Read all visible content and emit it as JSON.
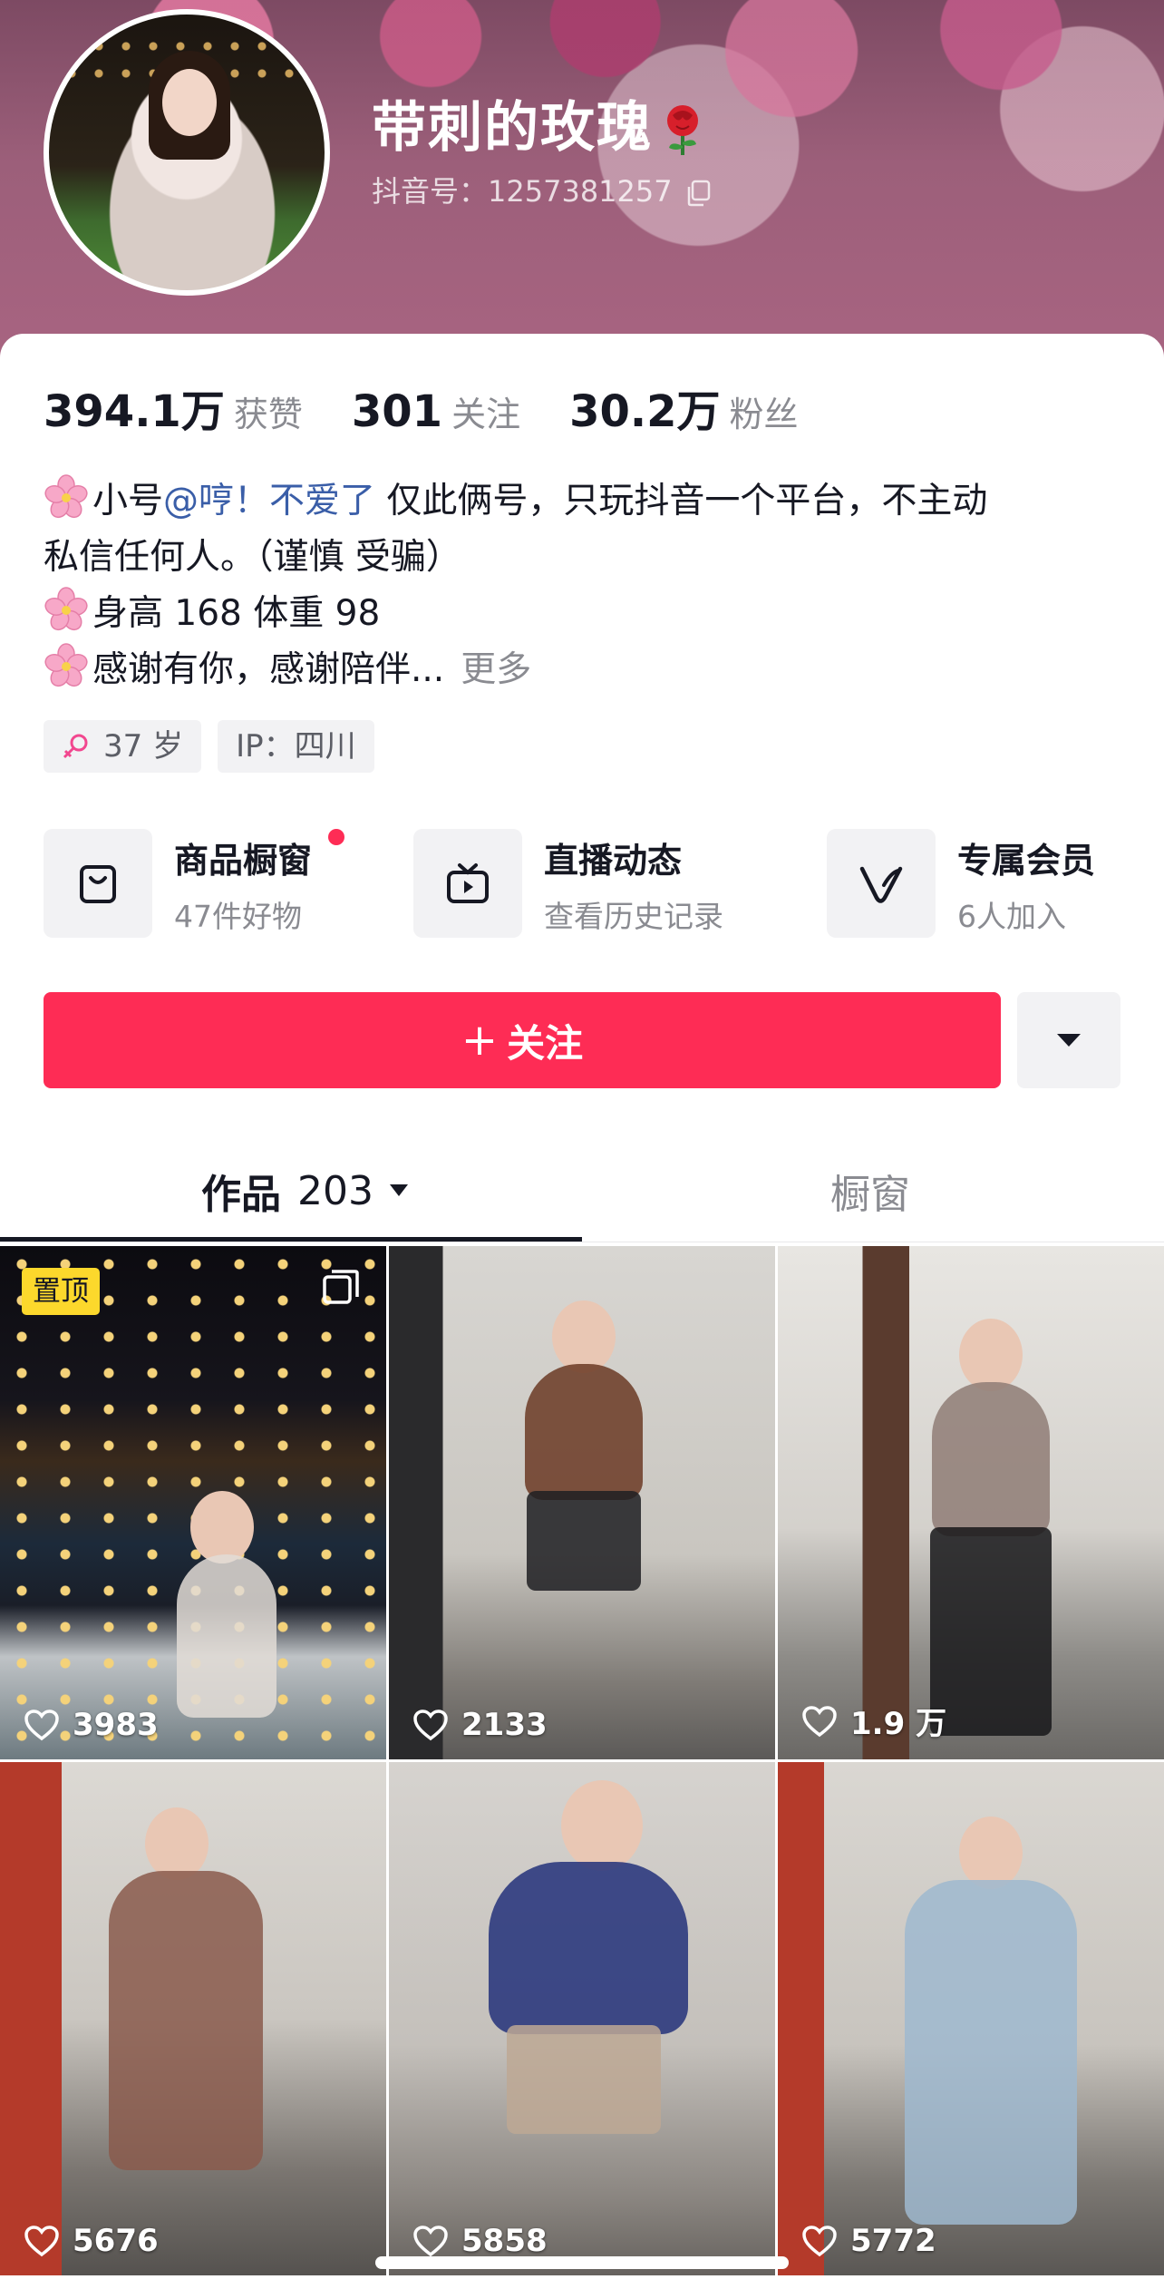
{
  "profile": {
    "username": "带刺的玫瑰",
    "id_label": "抖音号：",
    "id_value": "1257381257"
  },
  "stats": {
    "likes_value": "394.1万",
    "likes_label": "获赞",
    "following_value": "301",
    "following_label": "关注",
    "followers_value": "30.2万",
    "followers_label": "粉丝"
  },
  "bio": {
    "line1_prefix": "小号",
    "line1_mention": "@哼！不爱了",
    "line1_suffix": " 仅此俩号，只玩抖音一个平台，不主动",
    "line2": "私信任何人。（谨慎   受骗）",
    "line3": "身高 168 体重 98",
    "line4": "感谢有你，感谢陪伴...",
    "more": "更多"
  },
  "tags": {
    "age": "37 岁",
    "ip": "IP：四川"
  },
  "entries": [
    {
      "title": "商品橱窗",
      "subtitle": "47件好物",
      "icon": "shopping-bag-icon"
    },
    {
      "title": "直播动态",
      "subtitle": "查看历史记录",
      "icon": "live-tv-icon"
    },
    {
      "title": "专属会员",
      "subtitle": "6人加入",
      "icon": "member-v-icon"
    }
  ],
  "actions": {
    "follow_plus": "+",
    "follow_label": "关注"
  },
  "tabs": {
    "works_label": "作品",
    "works_count": "203",
    "showcase_label": "橱窗"
  },
  "grid": {
    "pinned_label": "置顶",
    "items": [
      {
        "likes": "3983"
      },
      {
        "likes": "2133"
      },
      {
        "likes": "1.9 万"
      },
      {
        "likes": "5676"
      },
      {
        "likes": "5858"
      },
      {
        "likes": "5772"
      }
    ]
  },
  "colors": {
    "accent": "#fe2c55",
    "mention": "#3a5ea8",
    "pinned_badge": "#fcd82c"
  }
}
